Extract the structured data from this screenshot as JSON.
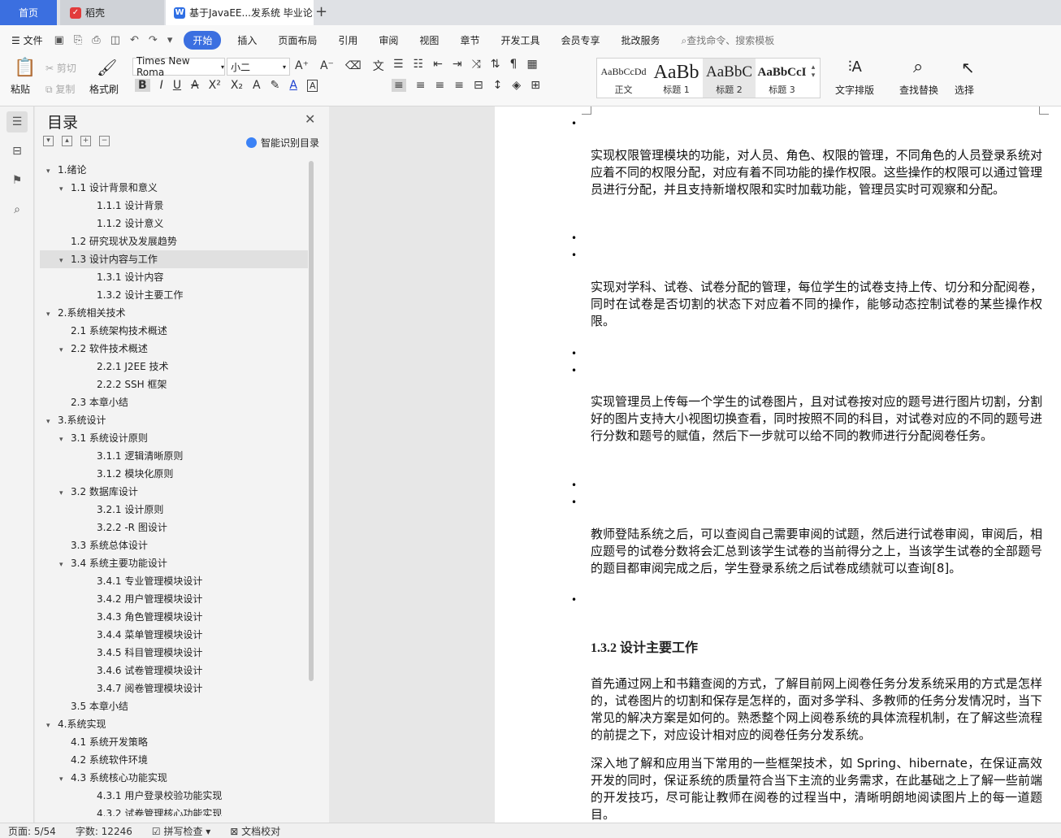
{
  "tabs": {
    "home": "首页",
    "daoke": "稻壳",
    "doc": "基于JavaEE...发系统 毕业论"
  },
  "menu": {
    "file": "文件",
    "items": [
      "开始",
      "插入",
      "页面布局",
      "引用",
      "审阅",
      "视图",
      "章节",
      "开发工具",
      "会员专享",
      "批改服务"
    ],
    "search": "查找命令、搜索模板"
  },
  "ribbon": {
    "paste": "粘贴",
    "cut": "剪切",
    "copy": "复制",
    "format_painter": "格式刷",
    "font_name": "Times New Roma",
    "font_size": "小二",
    "styles": [
      {
        "sample": "AaBbCcDd",
        "label": "正文"
      },
      {
        "sample": "AaBb",
        "label": "标题 1"
      },
      {
        "sample": "AaBbC",
        "label": "标题 2"
      },
      {
        "sample": "AaBbCcI",
        "label": "标题 3"
      }
    ],
    "text_layout": "文字排版",
    "find_replace": "查找替换",
    "select": "选择"
  },
  "toc": {
    "title": "目录",
    "smart": "智能识别目录",
    "items": [
      {
        "t": "1.绪论",
        "l": 1,
        "a": true
      },
      {
        "t": "1.1  设计背景和意义",
        "l": 2,
        "a": true
      },
      {
        "t": "1.1.1  设计背景",
        "l": 3
      },
      {
        "t": "1.1.2  设计意义",
        "l": 3
      },
      {
        "t": "1.2  研究现状及发展趋势",
        "l": 2
      },
      {
        "t": "1.3  设计内容与工作",
        "l": 2,
        "a": true,
        "sel": true
      },
      {
        "t": "1.3.1  设计内容",
        "l": 3
      },
      {
        "t": "1.3.2  设计主要工作",
        "l": 3
      },
      {
        "t": "2.系统相关技术",
        "l": 1,
        "a": true
      },
      {
        "t": "2.1  系统架构技术概述",
        "l": 2
      },
      {
        "t": "2.2  软件技术概述",
        "l": 2,
        "a": true
      },
      {
        "t": "2.2.1  J2EE  技术",
        "l": 3
      },
      {
        "t": "2.2.2 SSH  框架",
        "l": 3
      },
      {
        "t": "2.3  本章小结",
        "l": 2
      },
      {
        "t": "3.系统设计",
        "l": 1,
        "a": true
      },
      {
        "t": "3.1  系统设计原则",
        "l": 2,
        "a": true
      },
      {
        "t": "3.1.1  逻辑清晰原则",
        "l": 3
      },
      {
        "t": "3.1.2  模块化原则",
        "l": 3
      },
      {
        "t": "3.2  数据库设计",
        "l": 2,
        "a": true
      },
      {
        "t": "3.2.1  设计原则",
        "l": 3
      },
      {
        "t": "3.2.2 -R  图设计",
        "l": 3
      },
      {
        "t": "3.3  系统总体设计",
        "l": 2
      },
      {
        "t": "3.4  系统主要功能设计",
        "l": 2,
        "a": true
      },
      {
        "t": "3.4.1  专业管理模块设计",
        "l": 3
      },
      {
        "t": "3.4.2 用户管理模块设计",
        "l": 3
      },
      {
        "t": "3.4.3  角色管理模块设计",
        "l": 3
      },
      {
        "t": "3.4.4 菜单管理模块设计",
        "l": 3
      },
      {
        "t": "3.4.5 科目管理模块设计",
        "l": 3
      },
      {
        "t": "3.4.6  试卷管理模块设计",
        "l": 3
      },
      {
        "t": "3.4.7  阅卷管理模块设计",
        "l": 3
      },
      {
        "t": "3.5  本章小结",
        "l": 2
      },
      {
        "t": "4.系统实现",
        "l": 1,
        "a": true
      },
      {
        "t": "4.1  系统开发策略",
        "l": 2
      },
      {
        "t": "4.2  系统软件环境",
        "l": 2
      },
      {
        "t": "4.3  系统核心功能实现",
        "l": 2,
        "a": true
      },
      {
        "t": "4.3.1  用户登录校验功能实现",
        "l": 3
      },
      {
        "t": "4.3.2  试卷管理核心功能实现",
        "l": 3
      }
    ]
  },
  "doc": {
    "p1": "实现权限管理模块的功能，对人员、角色、权限的管理，不同角色的人员登录系统对应着不同的权限分配，对应有着不同功能的操作权限。这些操作的权限可以通过管理员进行分配，并且支持新增权限和实时加载功能，管理员实时可观察和分配。",
    "p2": "实现对学科、试卷、试卷分配的管理，每位学生的试卷支持上传、切分和分配阅卷，同时在试卷是否切割的状态下对应着不同的操作，能够动态控制试卷的某些操作权限。",
    "p3": "实现管理员上传每一个学生的试卷图片，且对试卷按对应的题号进行图片切割，分割好的图片支持大小视图切换查看，同时按照不同的科目，对试卷对应的不同的题号进行分数和题号的赋值，然后下一步就可以给不同的教师进行分配阅卷任务。",
    "p4": "教师登陆系统之后，可以查阅自己需要审阅的试题，然后进行试卷审阅，审阅后，相应题号的试卷分数将会汇总到该学生试卷的当前得分之上，当该学生试卷的全部题号的题目都审阅完成之后，学生登录系统之后试卷成绩就可以查询[8]。",
    "heading": "1.3.2  设计主要工作",
    "p5": "首先通过网上和书籍查阅的方式，了解目前网上阅卷任务分发系统采用的方式是怎样的，试卷图片的切割和保存是怎样的，面对多学科、多教师的任务分发情况时，当下常见的解决方案是如何的。熟悉整个网上阅卷系统的具体流程机制，在了解这些流程的前提之下，对应设计相对应的阅卷任务分发系统。",
    "p6": "深入地了解和应用当下常用的一些框架技术，如 Spring、hibernate，在保证高效开发的同时，保证系统的质量符合当下主流的业务需求，在此基础之上了解一些前端的开发技巧，尽可能让教师在阅卷的过程当中，清晰明朗地阅读图片上的每一道题目。",
    "bullet": "•"
  },
  "status": {
    "page": "页面: 5/54",
    "words": "字数: 12246",
    "spell": "拼写检查",
    "proof": "文档校对"
  }
}
